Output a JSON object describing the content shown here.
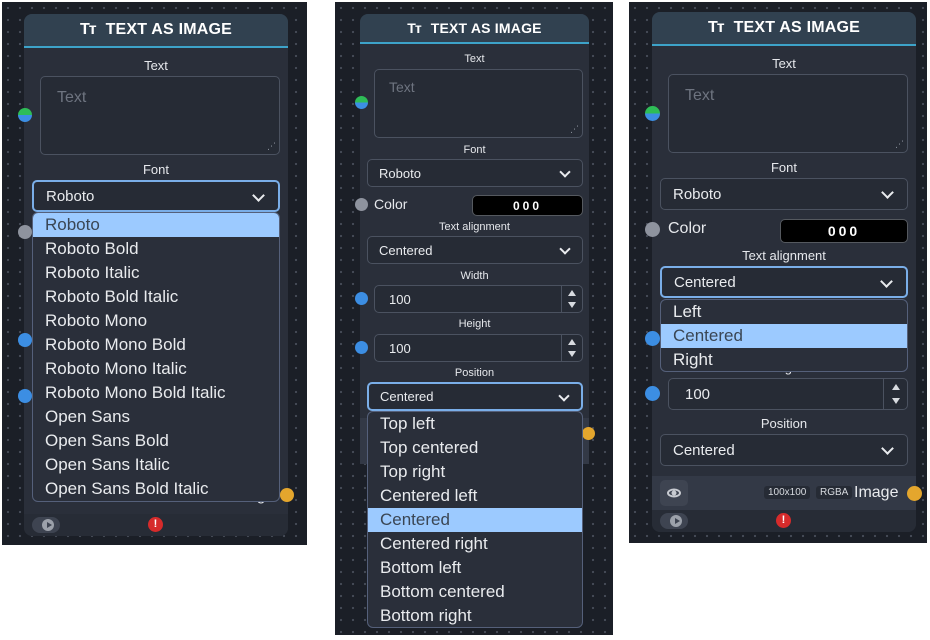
{
  "node_title": "TEXT AS IMAGE",
  "title_icon_glyph": "Tт",
  "labels": {
    "text": "Text",
    "font": "Font",
    "color": "Color",
    "text_alignment": "Text alignment",
    "width": "Width",
    "height": "Height",
    "position": "Position",
    "output": "Image"
  },
  "text_placeholder": "Text",
  "color_value": "000",
  "font_value": "Roboto",
  "alignment_value": "Centered",
  "width_value": "100",
  "height_value": "100",
  "position_value": "Centered",
  "output_chips": [
    "100x100",
    "RGBA"
  ],
  "partial_labels": {
    "image_behind_dropdown": "Image",
    "height_behind_dropdown": "Height"
  },
  "font_options": [
    "Roboto",
    "Roboto Bold",
    "Roboto Italic",
    "Roboto Bold Italic",
    "Roboto Mono",
    "Roboto Mono Bold",
    "Roboto Mono Italic",
    "Roboto Mono Bold Italic",
    "Open Sans",
    "Open Sans Bold",
    "Open Sans Italic",
    "Open Sans Bold Italic"
  ],
  "font_selected_index": 0,
  "position_options": [
    "Top left",
    "Top centered",
    "Top right",
    "Centered left",
    "Centered",
    "Centered right",
    "Bottom left",
    "Bottom centered",
    "Bottom right"
  ],
  "position_selected_index": 4,
  "alignment_options": [
    "Left",
    "Centered",
    "Right"
  ],
  "alignment_selected_index": 1,
  "icons": [
    "text-type-icon",
    "resize-grip-icon",
    "chevron-down-icon",
    "spinner-up-icon",
    "spinner-down-icon",
    "eye-icon",
    "play-icon",
    "error-icon"
  ],
  "colors": {
    "canvas_bg": "#1b1f27",
    "node_bg": "#2a2f3a",
    "header_bg": "#314150",
    "header_accent": "#3da3c9",
    "selected_option": "#9ccaff",
    "socket_blue": "#3c8ee3",
    "socket_green": "#2ebd57",
    "socket_gray": "#8e939e",
    "socket_orange": "#e4a62d",
    "error_red": "#d62b2b",
    "focus_border": "#7aaee8"
  }
}
